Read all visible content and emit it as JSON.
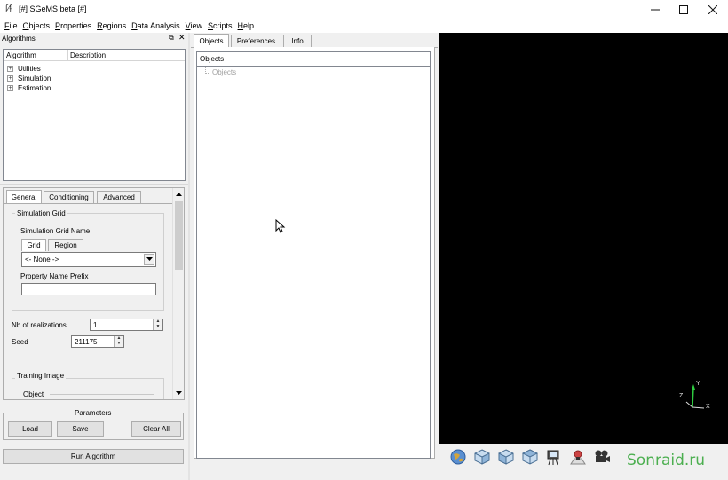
{
  "window": {
    "app_icon": "sgems-icon",
    "title": "[#] SGeMS beta [#]",
    "controls": {
      "minimize": "—",
      "maximize": "☐",
      "close": "✕"
    }
  },
  "menubar": [
    {
      "u": "F",
      "rest": "ile"
    },
    {
      "u": "O",
      "rest": "bjects"
    },
    {
      "u": "P",
      "rest": "roperties"
    },
    {
      "u": "R",
      "rest": "egions"
    },
    {
      "u": "D",
      "rest": "ata Analysis"
    },
    {
      "u": "V",
      "rest": "iew"
    },
    {
      "u": "S",
      "rest": "cripts"
    },
    {
      "u": "H",
      "rest": "elp"
    }
  ],
  "algorithms_panel": {
    "title": "Algorithms",
    "columns": [
      "Algorithm",
      "Description"
    ],
    "tree": [
      {
        "expander": "+",
        "label": "Utilities"
      },
      {
        "expander": "+",
        "label": "Simulation"
      },
      {
        "expander": "+",
        "label": "Estimation"
      }
    ]
  },
  "params_panel": {
    "tabs": [
      "General",
      "Conditioning",
      "Advanced"
    ],
    "active_tab": "General",
    "simulation_grid": {
      "group_label": "Simulation Grid",
      "grid_name_label": "Simulation Grid Name",
      "subtabs": [
        "Grid",
        "Region"
      ],
      "grid_select_value": "<- None ->",
      "property_prefix_label": "Property Name Prefix",
      "property_prefix_value": ""
    },
    "nb_realizations_label": "Nb of realizations",
    "nb_realizations_value": "1",
    "seed_label": "Seed",
    "seed_value": "211175",
    "training_image": {
      "group_label": "Training Image",
      "object_label": "Object"
    }
  },
  "parameters_group": {
    "label": "Parameters",
    "load": "Load",
    "save": "Save",
    "clear_all": "Clear All"
  },
  "run_button": "Run Algorithm",
  "objects_panel": {
    "tabs": [
      "Objects",
      "Preferences",
      "Info"
    ],
    "active_tab": "Objects",
    "header": "Objects",
    "tree_root": "Objects"
  },
  "viewer": {
    "background": "#000000",
    "axis": {
      "y": "Y",
      "z": "Z",
      "x": "X"
    }
  },
  "viewer_toolbar": {
    "icons": [
      "globe-view-icon",
      "cube-front-icon",
      "cube-side-icon",
      "cube-top-icon",
      "camera-snapshot-icon",
      "screenshot-icon",
      "movie-camera-icon"
    ],
    "watermark": "Sonraid.ru"
  },
  "cursor": "arrow-cursor-icon"
}
